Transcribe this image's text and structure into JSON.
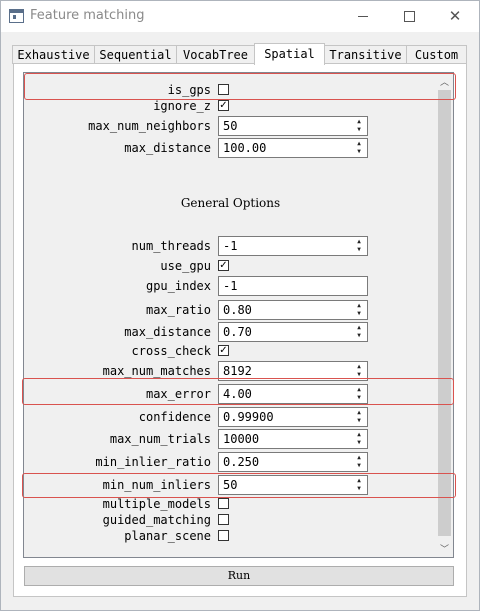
{
  "window": {
    "title": "Feature matching"
  },
  "tabs": [
    {
      "label": "Exhaustive"
    },
    {
      "label": "Sequential"
    },
    {
      "label": "VocabTree"
    },
    {
      "label": "Spatial"
    },
    {
      "label": "Transitive"
    },
    {
      "label": "Custom"
    }
  ],
  "active_tab": "Spatial",
  "spatial": {
    "is_gps": {
      "label": "is_gps",
      "checked": false
    },
    "ignore_z": {
      "label": "ignore_z",
      "checked": true
    },
    "max_num_neighbors": {
      "label": "max_num_neighbors",
      "value": "50"
    },
    "max_distance": {
      "label": "max_distance",
      "value": "100.00"
    }
  },
  "general": {
    "title": "General Options",
    "num_threads": {
      "label": "num_threads",
      "value": "-1"
    },
    "use_gpu": {
      "label": "use_gpu",
      "checked": true
    },
    "gpu_index": {
      "label": "gpu_index",
      "value": "-1"
    },
    "max_ratio": {
      "label": "max_ratio",
      "value": "0.80"
    },
    "max_distance": {
      "label": "max_distance",
      "value": "0.70"
    },
    "cross_check": {
      "label": "cross_check",
      "checked": true
    },
    "max_num_matches": {
      "label": "max_num_matches",
      "value": "8192"
    },
    "max_error": {
      "label": "max_error",
      "value": "4.00"
    },
    "confidence": {
      "label": "confidence",
      "value": "0.99900"
    },
    "max_num_trials": {
      "label": "max_num_trials",
      "value": "10000"
    },
    "min_inlier_ratio": {
      "label": "min_inlier_ratio",
      "value": "0.250"
    },
    "min_num_inliers": {
      "label": "min_num_inliers",
      "value": "50"
    },
    "multiple_models": {
      "label": "multiple_models",
      "checked": false
    },
    "guided_matching": {
      "label": "guided_matching",
      "checked": false
    },
    "planar_scene": {
      "label": "planar_scene",
      "checked": false
    }
  },
  "run_button": {
    "label": "Run"
  },
  "icons": {
    "check_mark": "✓",
    "spin_up": "▲",
    "spin_down": "▼",
    "scroll_up": "︿",
    "scroll_down": "﹀"
  },
  "colors": {
    "highlight": "#d9534f"
  }
}
